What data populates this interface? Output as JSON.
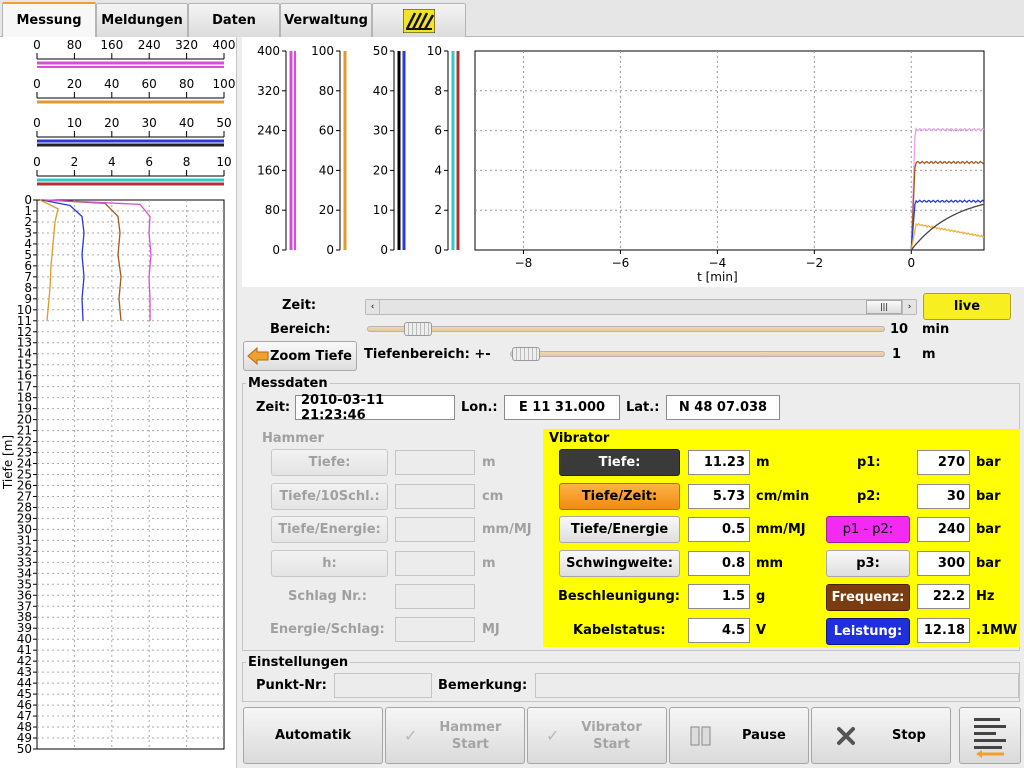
{
  "tabs": [
    {
      "label": "Messung",
      "active": true
    },
    {
      "label": "Meldungen"
    },
    {
      "label": "Daten"
    },
    {
      "label": "Verwaltung"
    }
  ],
  "left_scales": [
    {
      "ticks": [
        "0",
        "80",
        "160",
        "240",
        "320",
        "400"
      ],
      "color": "#d64fd6"
    },
    {
      "ticks": [
        "0",
        "20",
        "40",
        "60",
        "80",
        "100"
      ],
      "color": "#e09a2a"
    },
    {
      "ticks": [
        "0",
        "10",
        "20",
        "30",
        "40",
        "50"
      ],
      "color": "#2a3ad6"
    },
    {
      "ticks": [
        "0",
        "2",
        "4",
        "6",
        "8",
        "10"
      ],
      "color": "#2cc9c9"
    }
  ],
  "depth_axis": {
    "label": "Tiefe [m]",
    "max": 50
  },
  "chart": {
    "left_axes": [
      {
        "ticks": [
          "400",
          "320",
          "240",
          "160",
          "80",
          "0"
        ],
        "color": "#d64fd6"
      },
      {
        "ticks": [
          "100",
          "80",
          "60",
          "40",
          "20",
          "0"
        ],
        "color": "#e09a2a"
      },
      {
        "ticks": [
          "50",
          "40",
          "30",
          "20",
          "10",
          "0"
        ],
        "color": "#2a3ad6"
      },
      {
        "ticks": [
          "10",
          "8",
          "6",
          "4",
          "2",
          "0"
        ],
        "color": "#2cc9c9"
      }
    ],
    "xticks": [
      "−8",
      "−6",
      "−4",
      "−2",
      "0"
    ],
    "xlabel": "t [min]"
  },
  "controls": {
    "zeit_label": "Zeit:",
    "live_label": "live",
    "bereich_label": "Bereich:",
    "bereich_value": "10",
    "bereich_unit": "min",
    "zoom_label": "Zoom Tiefe",
    "tiefenbereich_label": "Tiefenbereich: +-",
    "tiefenbereich_value": "1",
    "tiefenbereich_unit": "m"
  },
  "messdaten": {
    "title": "Messdaten",
    "zeit_label": "Zeit:",
    "zeit_value": "2010-03-11 21:23:46",
    "lon_label": "Lon.:",
    "lon_value": "E 11 31.000",
    "lat_label": "Lat.:",
    "lat_value": "N 48 07.038"
  },
  "hammer": {
    "title": "Hammer",
    "tiefe": "Tiefe:",
    "tiefe_unit": "m",
    "tiefe10": "Tiefe/10Schl.:",
    "tiefe10_unit": "cm",
    "tiefeenergie": "Tiefe/Energie:",
    "tiefeenergie_unit": "mm/MJ",
    "h": "h:",
    "h_unit": "m",
    "schlag": "Schlag Nr.:",
    "energie": "Energie/Schlag:",
    "energie_unit": "MJ"
  },
  "vibrator": {
    "title": "Vibrator",
    "tiefe_btn": "Tiefe:",
    "tiefe_value": "11.23",
    "tiefe_unit": "m",
    "tiefezeit_btn": "Tiefe/Zeit:",
    "tiefezeit_value": "5.73",
    "tiefezeit_unit": "cm/min",
    "tiefeenergie_btn": "Tiefe/Energie",
    "tiefeenergie_value": "0.5",
    "tiefeenergie_unit": "mm/MJ",
    "schwing_btn": "Schwingweite:",
    "schwing_value": "0.8",
    "schwing_unit": "mm",
    "beschl_label": "Beschleunigung:",
    "beschl_value": "1.5",
    "beschl_unit": "g",
    "kabel_label": "Kabelstatus:",
    "kabel_value": "4.5",
    "kabel_unit": "V",
    "p1_label": "p1:",
    "p1_value": "270",
    "p1_unit": "bar",
    "p2_label": "p2:",
    "p2_value": "30",
    "p2_unit": "bar",
    "p1p2_btn": "p1 - p2:",
    "p1p2_value": "240",
    "p1p2_unit": "bar",
    "p3_btn": "p3:",
    "p3_value": "300",
    "p3_unit": "bar",
    "freq_btn": "Frequenz:",
    "freq_value": "22.2",
    "freq_unit": "Hz",
    "leistung_btn": "Leistung:",
    "leistung_value": "12.18",
    "leistung_unit": ".1MW"
  },
  "einstellungen": {
    "title": "Einstellungen",
    "punkt_label": "Punkt-Nr:",
    "bemerkung_label": "Bemerkung:"
  },
  "bottom": {
    "automatik": "Automatik",
    "hammer_start": "Hammer\nStart",
    "vibrator_start": "Vibrator\nStart",
    "pause": "Pause",
    "stop": "Stop"
  }
}
